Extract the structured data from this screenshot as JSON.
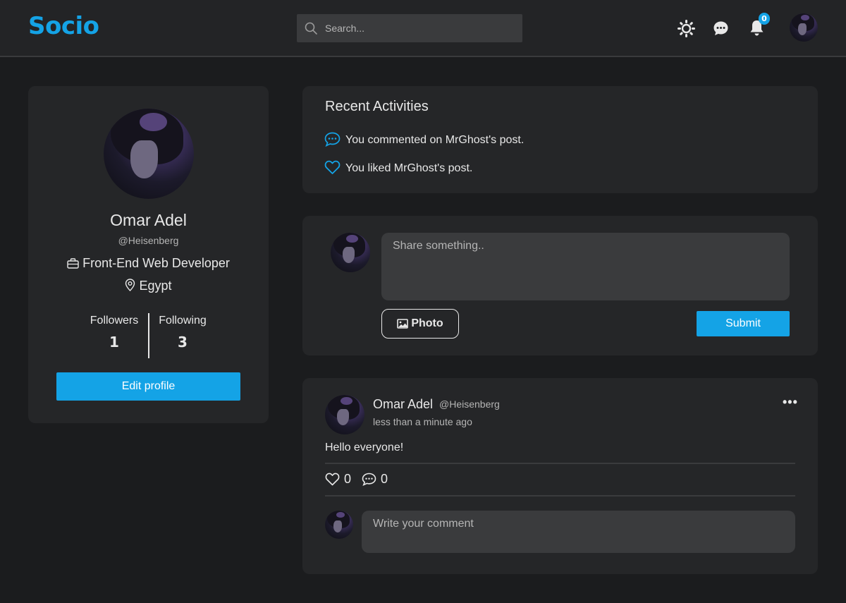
{
  "header": {
    "logo": "Socio",
    "search_placeholder": "Search...",
    "notification_count": "0",
    "icons": [
      "sun-icon",
      "chat-icon",
      "bell-icon",
      "user-avatar"
    ]
  },
  "profile": {
    "name": "Omar Adel",
    "handle": "@Heisenberg",
    "title": "Front-End Web Developer",
    "location": "Egypt",
    "followers_label": "Followers",
    "followers_count": "1",
    "following_label": "Following",
    "following_count": "3",
    "edit_button": "Edit profile"
  },
  "activities": {
    "title": "Recent Activities",
    "items": [
      {
        "icon": "comment-icon",
        "text": "You commented on MrGhost's post."
      },
      {
        "icon": "heart-icon",
        "text": "You liked MrGhost's post."
      }
    ]
  },
  "composer": {
    "placeholder": "Share something..",
    "photo_button": "Photo",
    "submit_button": "Submit"
  },
  "post": {
    "author": "Omar Adel",
    "handle": "@Heisenberg",
    "time": "less than a minute ago",
    "text": "Hello everyone!",
    "likes": "0",
    "comments": "0",
    "comment_placeholder": "Write your comment"
  },
  "colors": {
    "accent": "#14a3e6",
    "background": "#1b1c1e",
    "card": "#252628",
    "header": "#232426",
    "input": "#3a3b3d"
  }
}
